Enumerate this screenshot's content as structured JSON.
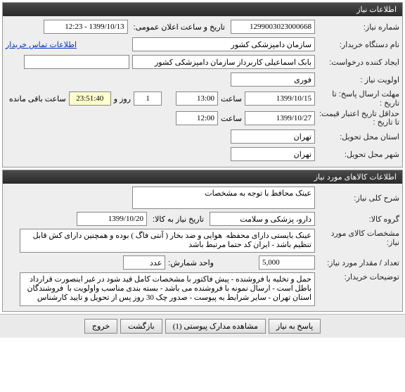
{
  "sections": {
    "need_info": "اطلاعات نیاز",
    "goods_info": "اطلاعات کالاهای مورد نیاز"
  },
  "labels": {
    "need_no": "شماره نیاز:",
    "public_datetime": "تاریخ و ساعت اعلان عمومی:",
    "buyer_org": "نام دستگاه خریدار:",
    "requesting_user": "ایجاد کننده درخواست:",
    "priority": "اولویت نیاز :",
    "response_deadline": "مهلت ارسال پاسخ:",
    "to_date": "تا تاریخ :",
    "time": "ساعت",
    "days": "روز و",
    "remaining": "ساعت باقی مانده",
    "min_validity": "حداقل تاریخ اعتبار قیمت:",
    "validity_to": "تا تاریخ :",
    "delivery_province": "استان محل تحویل:",
    "delivery_city": "شهر محل تحویل:",
    "general_desc": "شرح کلی نیاز:",
    "goods_group": "گروه کالا:",
    "goods_date": "تاریخ نیاز به کالا:",
    "goods_spec": "مشخصات کالای مورد نیاز:",
    "quantity": "تعداد / مقدار مورد نیاز:",
    "unit": "واحد شمارش:",
    "buyer_notes": "توضیحات خریدار:",
    "contact_link": "اطلاعات تماس خریدار"
  },
  "values": {
    "need_no": "1299003023000668",
    "public_datetime": "1399/10/13 - 12:23",
    "buyer_org": "سازمان دامپزشکی کشور",
    "requesting_user": "بابک اسماعیلی کاربرداز سازمان دامپزشکی کشور",
    "priority": "فوری",
    "deadline_date": "1399/10/15",
    "deadline_time": "13:00",
    "remaining_days": "1",
    "remaining_time": "23:51:40",
    "validity_date": "1399/10/27",
    "validity_time": "12:00",
    "province": "تهران",
    "city": "تهران",
    "general_desc": "عینک محافظ با توجه به مشخصات",
    "goods_group": "دارو، پزشکی و سلامت",
    "goods_date": "1399/10/20",
    "goods_spec": "عینک بایستی دارای محفظه  هوایی و ضد بخار ( آنتی فاگ ) بوده و همچنین دارای کش قابل تنظیم باشد - ایران کد حتما مرتبط باشد",
    "quantity": "5,000",
    "unit": "عدد",
    "buyer_notes": "حمل و تخلیه با فروشنده - پیش فاکتور با مشخصات کامل قید شود در غیر اینصورت قرارداد باطل است - ارسال نمونه با فروشنده می باشد - بسته بندی مناسب واولویت با  فروشندگان استان تهران - سایر شرایط به پیوست - صدور چک 30 روز پس از تحویل و تایید کارشناس"
  },
  "buttons": {
    "reply": "پاسخ به نیاز",
    "attachments": "مشاهده مدارک پیوستی (1)",
    "back": "بازگشت",
    "exit": "خروج"
  }
}
